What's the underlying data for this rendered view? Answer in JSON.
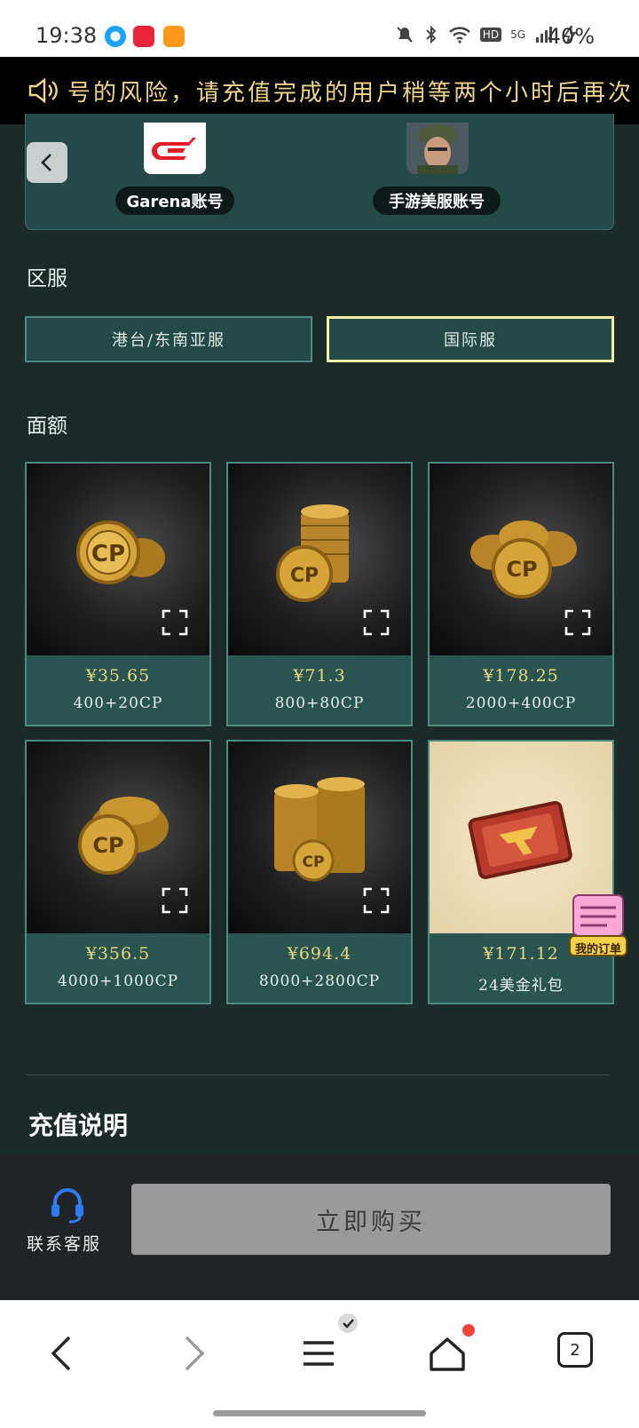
{
  "status_bar": {
    "time": "19:38",
    "battery": "40%",
    "network_badges": [
      "HD",
      "5G"
    ]
  },
  "marquee": {
    "text": "号的风险，请充值完成的用户稍等两个小时后再次"
  },
  "accounts": [
    {
      "label": "Garena账号"
    },
    {
      "label": "手游美服账号"
    }
  ],
  "region": {
    "title": "区服",
    "options": [
      {
        "label": "港台/东南亚服",
        "selected": false
      },
      {
        "label": "国际服",
        "selected": true
      }
    ]
  },
  "denomination": {
    "title": "面额",
    "items": [
      {
        "price": "¥35.65",
        "desc": "400+20CP",
        "image": "cp-coins-small"
      },
      {
        "price": "¥71.3",
        "desc": "800+80CP",
        "image": "cp-coin-stack"
      },
      {
        "price": "¥178.25",
        "desc": "2000+400CP",
        "image": "cp-coin-pile"
      },
      {
        "price": "¥356.5",
        "desc": "4000+1000CP",
        "image": "cp-coin-heap"
      },
      {
        "price": "¥694.4",
        "desc": "8000+2800CP",
        "image": "cp-coin-towers"
      },
      {
        "price": "¥171.12",
        "desc": "24美金礼包",
        "image": "gift-pack"
      }
    ]
  },
  "notes": {
    "title": "充值说明"
  },
  "bottom_bar": {
    "customer_service_label": "联系客服",
    "buy_label": "立即购买"
  },
  "floating": {
    "my_orders_label": "我的订单"
  },
  "nav": {
    "tab_count": "2"
  },
  "colors": {
    "background": "#1a2b2a",
    "panel": "#244a47",
    "accent_gold": "#e9d77f",
    "selected_border": "#f3efa7",
    "buy_disabled": "#9a9a9a"
  }
}
